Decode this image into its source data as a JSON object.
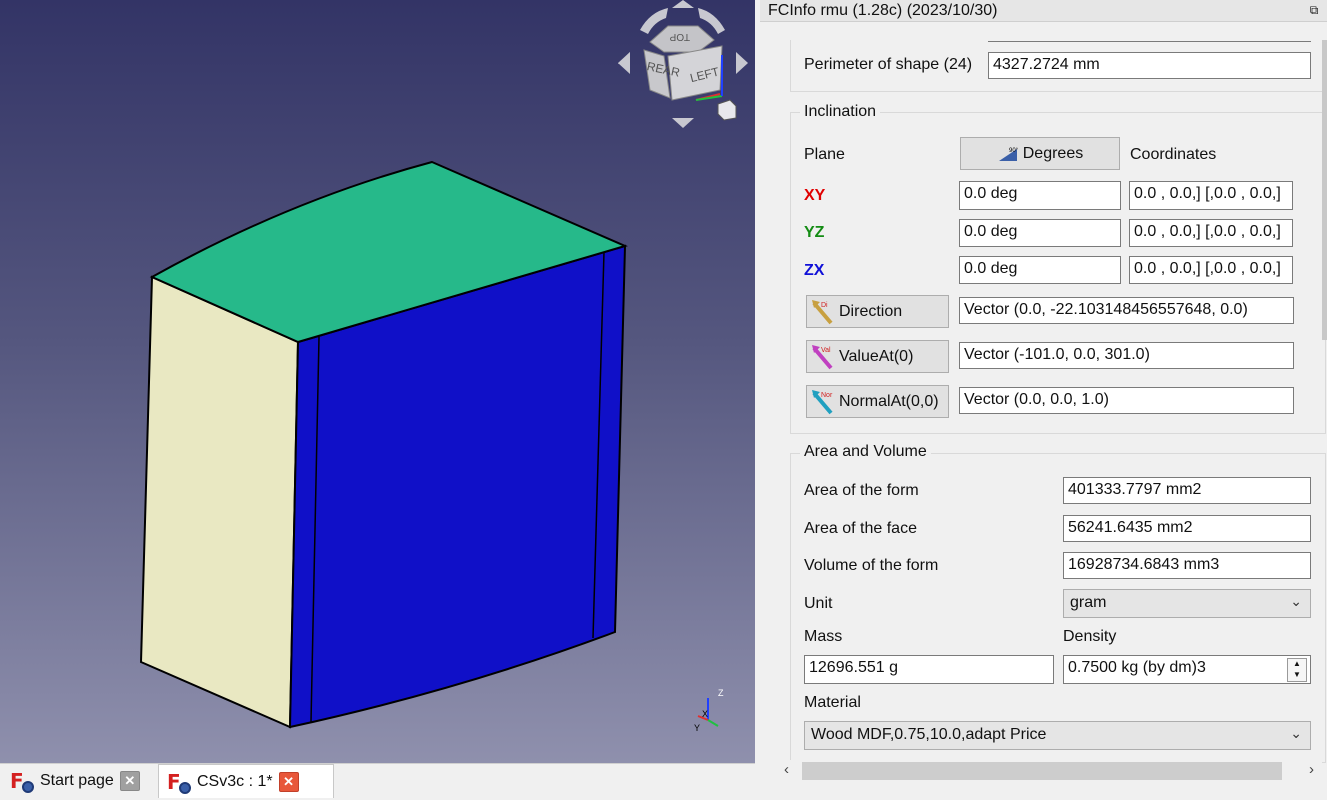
{
  "panel": {
    "title": "FCInfo rmu (1.28c) (2023/10/30)",
    "perimeter": {
      "label": "Perimeter of shape (24)",
      "value": "4327.2724 mm"
    },
    "inclination": {
      "title": "Inclination",
      "plane_label": "Plane",
      "degrees_button": "Degrees",
      "coordinates_label": "Coordinates",
      "rows": [
        {
          "plane": "XY",
          "color": "#e00000",
          "deg": "0.0 deg",
          "coords": "0.0 , 0.0,]  [,0.0 , 0.0,]"
        },
        {
          "plane": "YZ",
          "color": "#148c14",
          "deg": "0.0 deg",
          "coords": "0.0 , 0.0,]  [,0.0 , 0.0,]"
        },
        {
          "plane": "ZX",
          "color": "#1010d8",
          "deg": "0.0 deg",
          "coords": "0.0 , 0.0,]  [,0.0 , 0.0,]"
        }
      ],
      "direction": {
        "label": "Direction",
        "value": "Vector (0.0, -22.103148456557648, 0.0)"
      },
      "value_at": {
        "label": "ValueAt(0)",
        "value": "Vector (-101.0, 0.0, 301.0)"
      },
      "normal_at": {
        "label": "NormalAt(0,0)",
        "value": "Vector (0.0, 0.0, 1.0)"
      }
    },
    "area_volume": {
      "title": "Area and Volume",
      "area_form": {
        "label": "Area of the form",
        "value": "401333.7797 mm2"
      },
      "area_face": {
        "label": "Area of the face",
        "value": "56241.6435 mm2"
      },
      "volume_form": {
        "label": "Volume of the form",
        "value": "16928734.6843 mm3"
      },
      "unit": {
        "label": "Unit",
        "value": "gram"
      },
      "mass": {
        "label": "Mass",
        "value": "12696.551 g"
      },
      "density": {
        "label": "Density",
        "value": "0.7500 kg (by dm)3"
      },
      "material": {
        "label": "Material",
        "value": "Wood MDF,0.75,10.0,adapt Price"
      }
    }
  },
  "navcube": {
    "top": "TOP",
    "rear": "REAR",
    "left": "LEFT"
  },
  "axes": {
    "x": "X",
    "y": "Y",
    "z": "Z"
  },
  "tabs": [
    {
      "label": "Start page",
      "active": false
    },
    {
      "label": "CSv3c : 1*",
      "active": true
    }
  ],
  "colors": {
    "top_face": "#26b98a",
    "left_face": "#e9e8c2",
    "front_face": "#1010c8",
    "viewport_top": "#333466",
    "viewport_bottom": "#8f90ad"
  }
}
